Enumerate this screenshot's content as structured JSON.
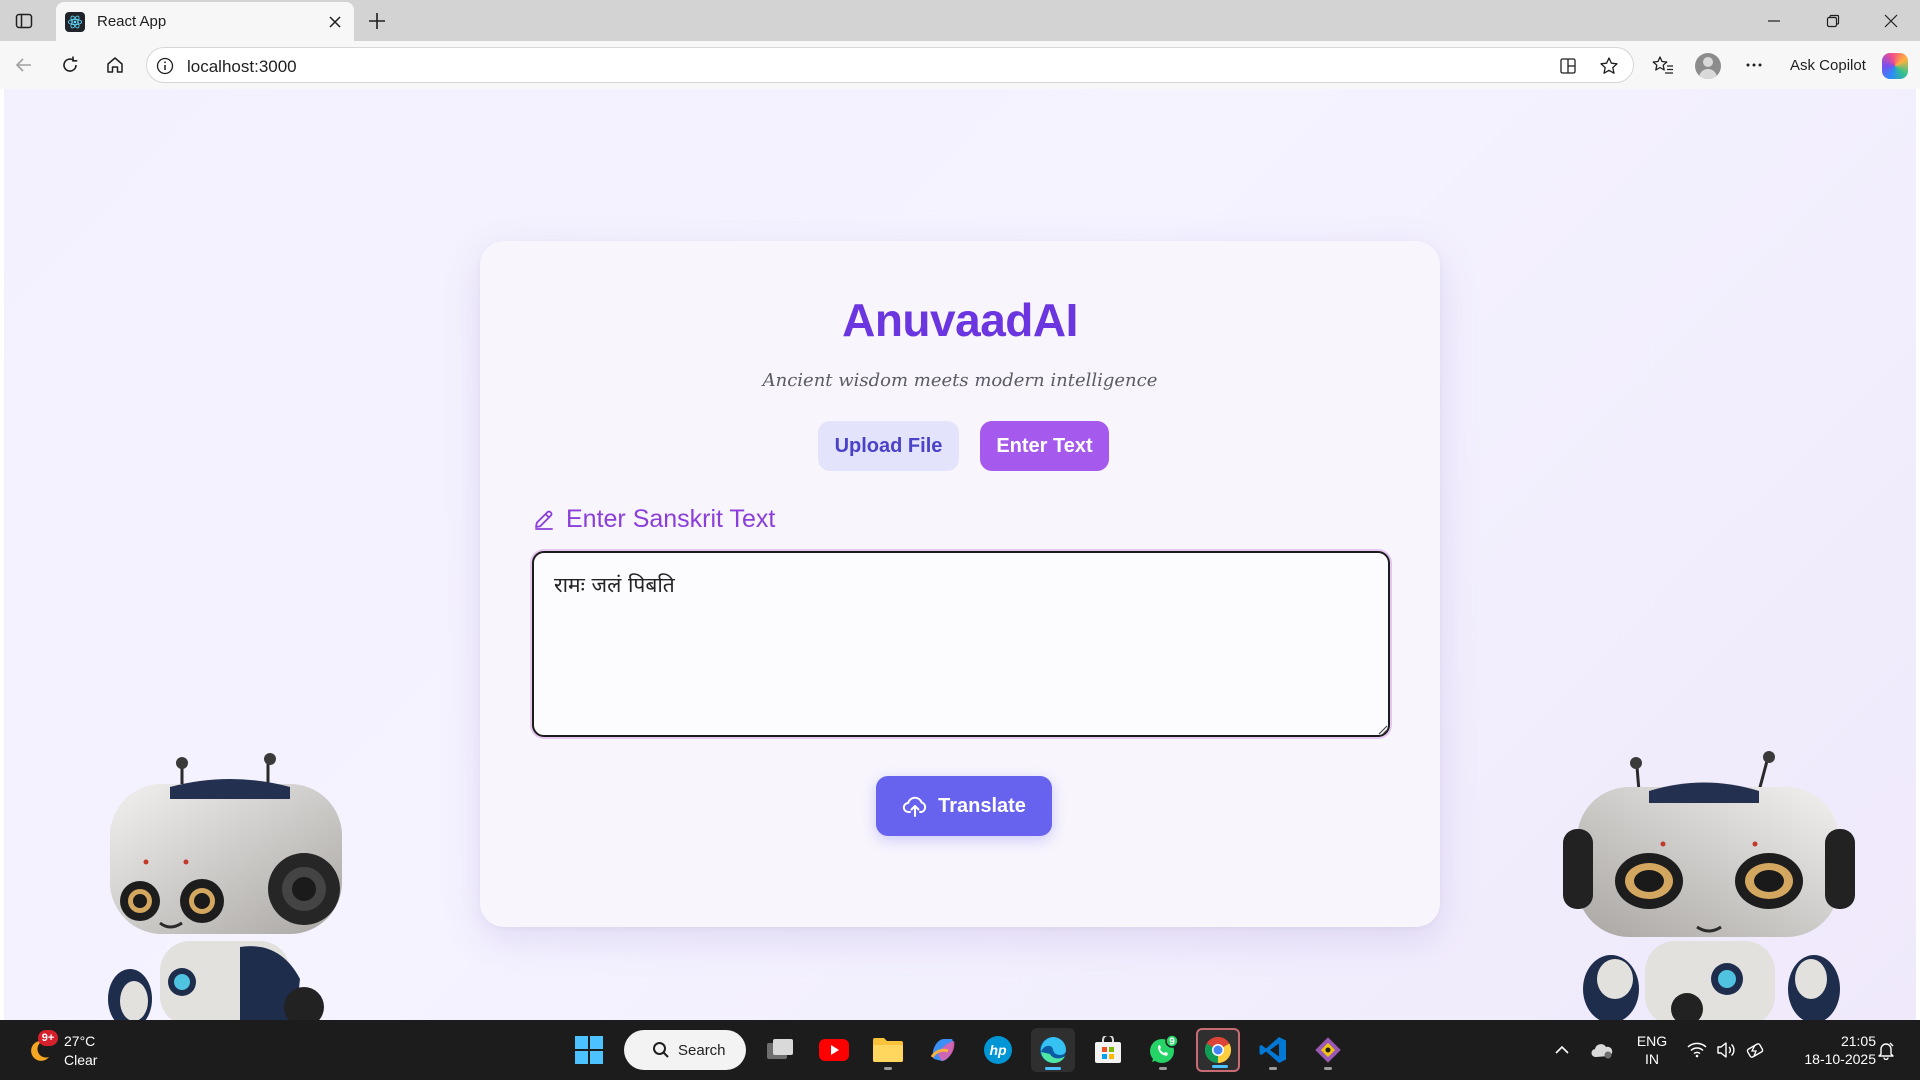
{
  "browser": {
    "tab_title": "React App",
    "url": "localhost:3000",
    "ask_copilot": "Ask Copilot"
  },
  "app": {
    "title": "AnuvaadAI",
    "subtitle": "Ancient wisdom meets modern intelligence",
    "upload_button": "Upload File",
    "enter_text_button": "Enter Text",
    "section_label": "Enter Sanskrit Text",
    "input_value": "रामः जलं पिबति",
    "translate_button": "Translate"
  },
  "colors": {
    "title_purple": "#6b36e0",
    "enter_text_purple": "#a559ed",
    "upload_lavender": "#e3e3fb",
    "translate_indigo": "#6863ee",
    "label_purple": "#8a3fd8"
  },
  "taskbar": {
    "weather_badge": "9+",
    "weather_temp": "27°C",
    "weather_condition": "Clear",
    "search_label": "Search",
    "whatsapp_badge": "9",
    "language_line1": "ENG",
    "language_line2": "IN",
    "time": "21:05",
    "date": "18-10-2025"
  }
}
